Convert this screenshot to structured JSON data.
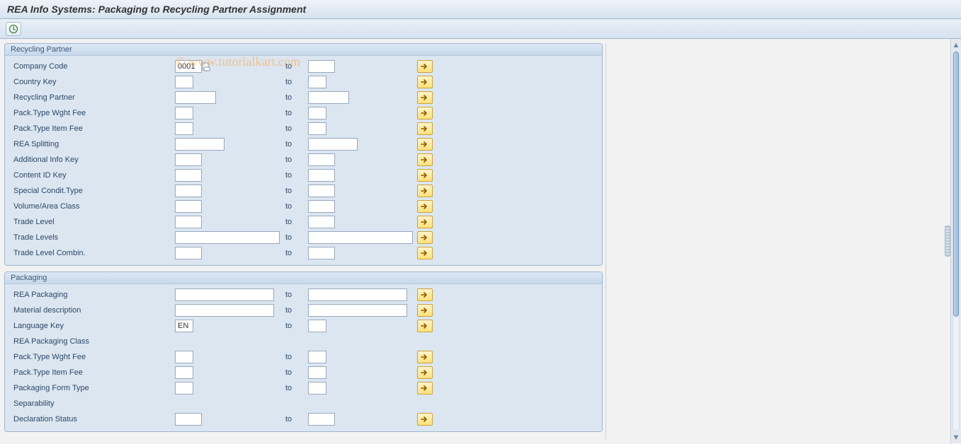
{
  "title": "REA Info Systems: Packaging to Recycling Partner Assignment",
  "watermark": "© www.tutorialkart.com",
  "common": {
    "to": "to"
  },
  "groups": {
    "recycling": {
      "title": "Recycling Partner",
      "rows": [
        {
          "label": "Company Code",
          "from": "0001",
          "to": "",
          "size": "s",
          "multi": true,
          "f4": true
        },
        {
          "label": "Country Key",
          "from": "",
          "to": "",
          "size": "xs",
          "multi": true
        },
        {
          "label": "Recycling Partner",
          "from": "",
          "to": "",
          "size": "m",
          "multi": true
        },
        {
          "label": "Pack.Type Wght Fee",
          "from": "",
          "to": "",
          "size": "xs",
          "multi": true
        },
        {
          "label": "Pack.Type Item Fee",
          "from": "",
          "to": "",
          "size": "xs",
          "multi": true
        },
        {
          "label": "REA Splitting",
          "from": "",
          "to": "",
          "size": "l",
          "multi": true
        },
        {
          "label": "Additional Info Key",
          "from": "",
          "to": "",
          "size": "s",
          "multi": true
        },
        {
          "label": "Content ID Key",
          "from": "",
          "to": "",
          "size": "s",
          "multi": true
        },
        {
          "label": "Special Condit.Type",
          "from": "",
          "to": "",
          "size": "s",
          "multi": true
        },
        {
          "label": "Volume/Area Class",
          "from": "",
          "to": "",
          "size": "s",
          "multi": true
        },
        {
          "label": "Trade Level",
          "from": "",
          "to": "",
          "size": "s",
          "multi": true
        },
        {
          "label": "Trade Levels",
          "from": "",
          "to": "",
          "size": "xxl",
          "multi": true
        },
        {
          "label": "Trade Level Combin.",
          "from": "",
          "to": "",
          "size": "s",
          "multi": true
        }
      ]
    },
    "packaging": {
      "title": "Packaging",
      "rows": [
        {
          "label": "REA Packaging",
          "from": "",
          "to": "",
          "size": "xl",
          "multi": true
        },
        {
          "label": "Material description",
          "from": "",
          "to": "",
          "size": "xl",
          "multi": true
        },
        {
          "label": "Language Key",
          "from": "EN",
          "to": "",
          "size": "xs",
          "multi": true
        },
        {
          "label": "REA Packaging Class",
          "from": "",
          "to": "",
          "size": "none",
          "multi": false
        },
        {
          "label": "Pack.Type Wght Fee",
          "from": "",
          "to": "",
          "size": "xs",
          "multi": true
        },
        {
          "label": "Pack.Type Item Fee",
          "from": "",
          "to": "",
          "size": "xs",
          "multi": true
        },
        {
          "label": "Packaging Form Type",
          "from": "",
          "to": "",
          "size": "xs",
          "multi": true
        },
        {
          "label": "Separability",
          "from": "",
          "to": "",
          "size": "none",
          "multi": false
        },
        {
          "label": "Declaration Status",
          "from": "",
          "to": "",
          "size": "s",
          "multi": true
        }
      ]
    }
  }
}
